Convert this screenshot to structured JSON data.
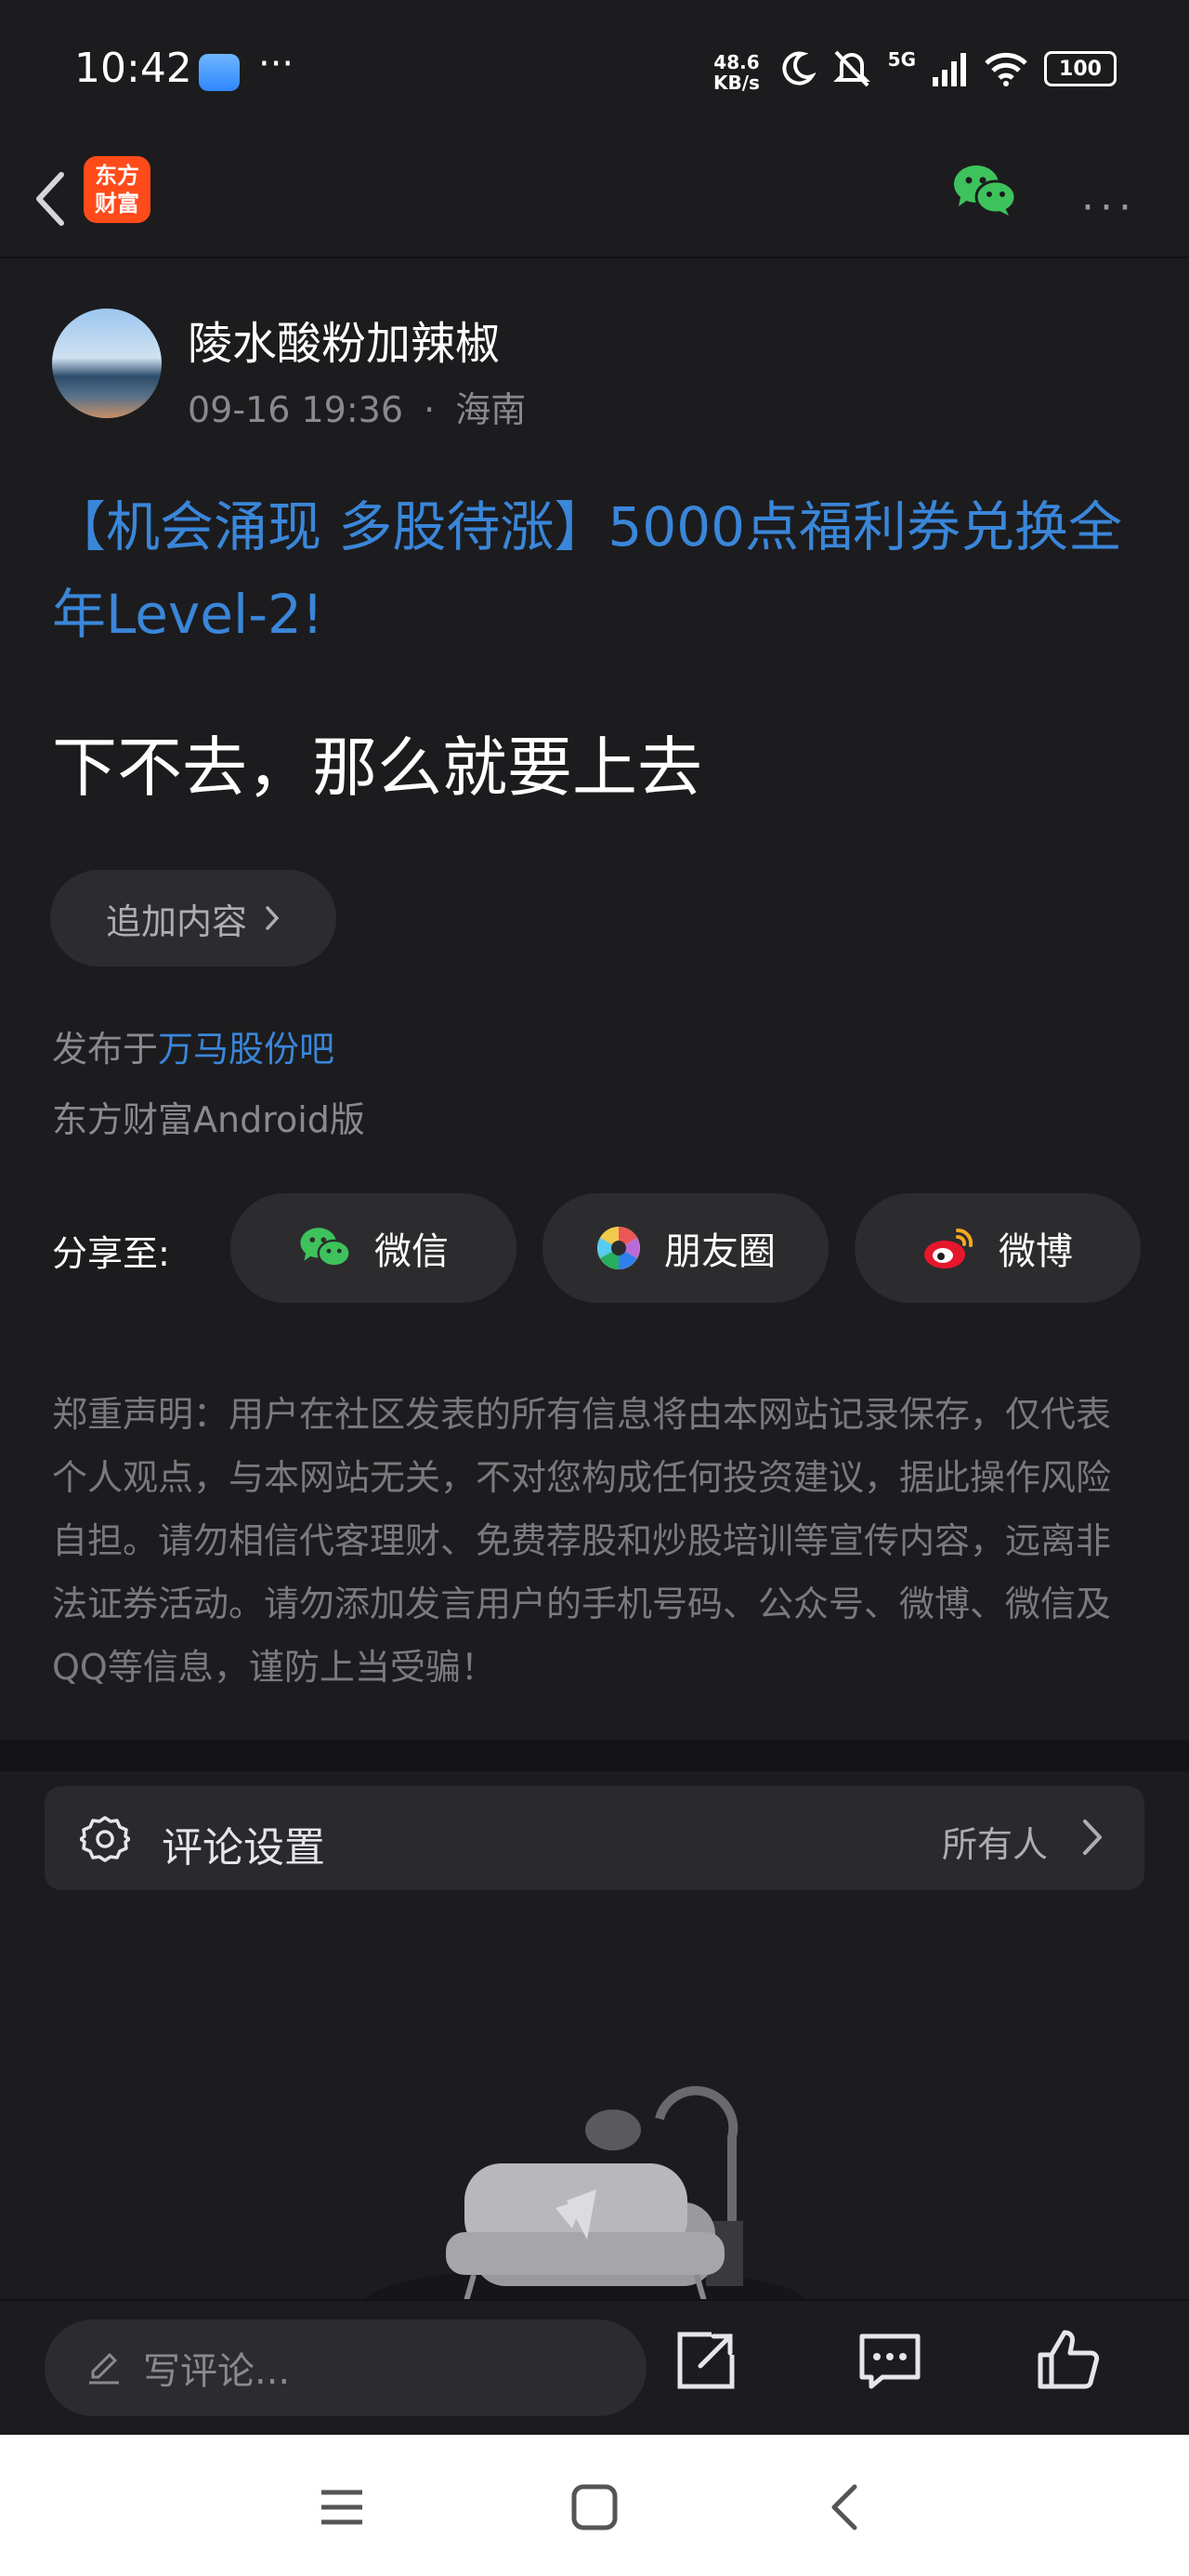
{
  "status_bar": {
    "time": "10:42",
    "net_speed_value": "48.6",
    "net_speed_unit": "KB/s",
    "signal_label": "5G",
    "battery": "100"
  },
  "nav": {
    "app_logo_line1": "东方",
    "app_logo_line2": "财富"
  },
  "post": {
    "author": "陵水酸粉加辣椒",
    "datetime": "09-16 19:36",
    "separator": "·",
    "location": "海南",
    "promo_text": "【机会涌现 多股待涨】5000点福利券兑换全年Level-2!",
    "body": "下不去，那么就要上去",
    "append_button": "追加内容",
    "published_prefix": "发布于",
    "published_bar": "万马股份吧",
    "client": "东方财富Android版"
  },
  "share": {
    "label": "分享至:",
    "wechat": "微信",
    "moments": "朋友圈",
    "weibo": "微博"
  },
  "disclaimer": "郑重声明：用户在社区发表的所有信息将由本网站记录保存，仅代表个人观点，与本网站无关，不对您构成任何投资建议，据此操作风险自担。请勿相信代客理财、免费荐股和炒股培训等宣传内容，远离非法证券活动。请勿添加发言用户的手机号码、公众号、微博、微信及QQ等信息，谨防上当受骗！",
  "comment_settings": {
    "label": "评论设置",
    "value": "所有人"
  },
  "bottom_bar": {
    "comment_placeholder": "写评论..."
  },
  "colors": {
    "background": "#1c1c1e",
    "accent_link": "#3a86d9",
    "wechat_green": "#3ec25b",
    "app_brand": "#ff4a1a"
  },
  "icons": [
    "back-arrow-icon",
    "wechat-icon",
    "more-icon",
    "gear-icon",
    "chevron-right-icon",
    "pen-icon",
    "share-out-icon",
    "comment-icon",
    "like-icon",
    "weibo-icon",
    "moments-icon"
  ]
}
